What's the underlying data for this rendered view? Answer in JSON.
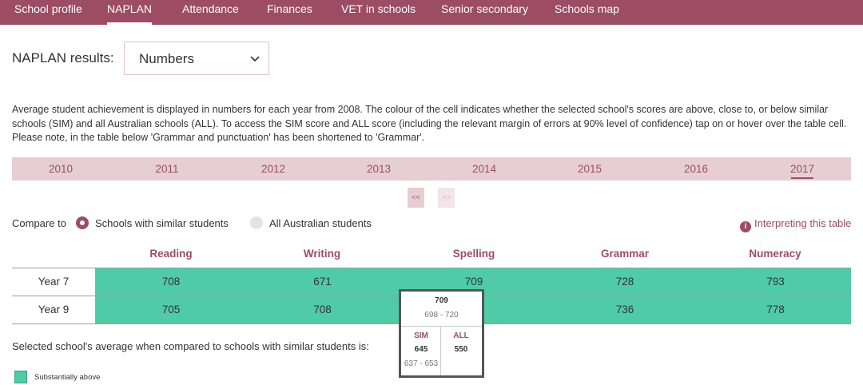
{
  "nav": {
    "items": [
      {
        "label": "School profile"
      },
      {
        "label": "NAPLAN"
      },
      {
        "label": "Attendance"
      },
      {
        "label": "Finances"
      },
      {
        "label": "VET in schools"
      },
      {
        "label": "Senior secondary"
      },
      {
        "label": "Schools map"
      }
    ],
    "active": "NAPLAN"
  },
  "naplan": {
    "label": "NAPLAN results:",
    "selected": "Numbers"
  },
  "description": "Average student achievement is displayed in numbers for each year from 2008. The colour of the cell indicates whether the selected school's scores are above, close to, or below similar schools (SIM) and all Australian schools (ALL). To access the SIM score and ALL score (including the relevant margin of errors at 90% level of confidence) tap on or hover over the table cell. Please note, in the table below 'Grammar and punctuation' has been shortened to 'Grammar'.",
  "years": [
    "2010",
    "2011",
    "2012",
    "2013",
    "2014",
    "2015",
    "2016",
    "2017"
  ],
  "selected_year": "2017",
  "pager": {
    "prev": "<<",
    "next": ">>"
  },
  "compare": {
    "label": "Compare to",
    "options": [
      {
        "label": "Schools with similar students",
        "selected": true
      },
      {
        "label": "All Australian students",
        "selected": false
      }
    ]
  },
  "interpreting": "Interpreting this table",
  "table": {
    "columns": [
      "Reading",
      "Writing",
      "Spelling",
      "Grammar",
      "Numeracy"
    ],
    "rows": [
      {
        "label": "Year 7",
        "values": [
          "708",
          "671",
          "709",
          "728",
          "793"
        ]
      },
      {
        "label": "Year 9",
        "values": [
          "705",
          "708",
          "",
          "736",
          "778"
        ]
      }
    ]
  },
  "tooltip": {
    "score": "709",
    "range": "698 - 720",
    "sim_label": "SIM",
    "sim_value": "645",
    "sim_range": "637 - 653",
    "all_label": "ALL",
    "all_value": "550"
  },
  "compare_text": "Selected school's average when compared to schools with similar students is:",
  "legend": {
    "label": "Substantially above",
    "color": "#4fcba8"
  },
  "colors": {
    "brand": "#9c4d63",
    "brand_light": "#e6ced4",
    "above": "#4fcba8"
  }
}
